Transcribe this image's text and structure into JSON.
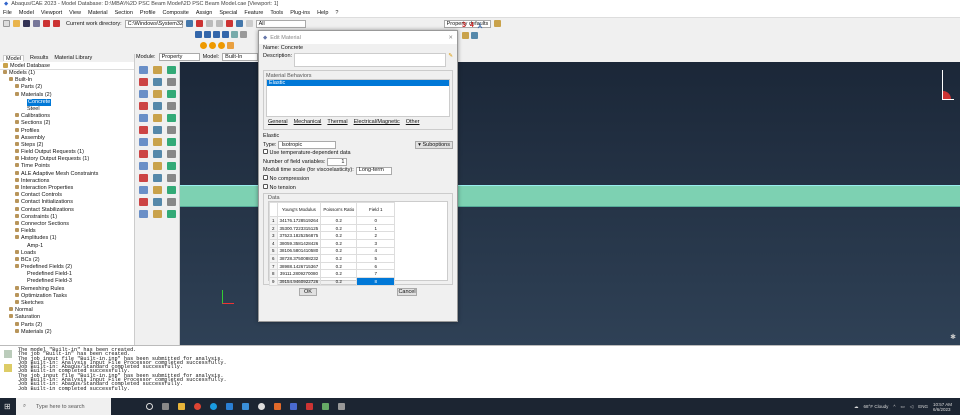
{
  "window": {
    "title": "Abaqus/CAE 2023 - Model Database: D:\\MBA\\%2D PSC Beam Model\\2D PSC Beam Model.cae [Viewport: 1]"
  },
  "menu": [
    "File",
    "Model",
    "Viewport",
    "View",
    "Material",
    "Section",
    "Profile",
    "Composite",
    "Assign",
    "Special",
    "Feature",
    "Tools",
    "Plug-ins",
    "Help",
    "?"
  ],
  "toolbar": {
    "workdir_label": "Current work directory:",
    "workdir_value": "C:\\Windows\\System32",
    "filter_value": "All",
    "property_defaults": "Property defaults"
  },
  "module_bar": {
    "module_label": "Module:",
    "module_value": "Property",
    "model_label": "Model:",
    "model_value": "Built-In"
  },
  "left_panel": {
    "tabs": [
      "Model",
      "Results",
      "Material Library"
    ],
    "header": "Model Database",
    "tree": [
      {
        "t": "Models (1)",
        "d": 0
      },
      {
        "t": "Built-In",
        "d": 1
      },
      {
        "t": "Parts (2)",
        "d": 2
      },
      {
        "t": "Materials (2)",
        "d": 2
      },
      {
        "t": "Concrete",
        "d": 3,
        "sel": true
      },
      {
        "t": "Steel",
        "d": 3
      },
      {
        "t": "Calibrations",
        "d": 2
      },
      {
        "t": "Sections (2)",
        "d": 2
      },
      {
        "t": "Profiles",
        "d": 2
      },
      {
        "t": "Assembly",
        "d": 2
      },
      {
        "t": "Steps (2)",
        "d": 2
      },
      {
        "t": "Field Output Requests (1)",
        "d": 2
      },
      {
        "t": "History Output Requests (1)",
        "d": 2
      },
      {
        "t": "Time Points",
        "d": 2
      },
      {
        "t": "ALE Adaptive Mesh Constraints",
        "d": 2
      },
      {
        "t": "Interactions",
        "d": 2
      },
      {
        "t": "Interaction Properties",
        "d": 2
      },
      {
        "t": "Contact Controls",
        "d": 2
      },
      {
        "t": "Contact Initializations",
        "d": 2
      },
      {
        "t": "Contact Stabilizations",
        "d": 2
      },
      {
        "t": "Constraints (1)",
        "d": 2
      },
      {
        "t": "Connector Sections",
        "d": 2
      },
      {
        "t": "Fields",
        "d": 2
      },
      {
        "t": "Amplitudes (1)",
        "d": 2
      },
      {
        "t": "Amp-1",
        "d": 3
      },
      {
        "t": "Loads",
        "d": 2
      },
      {
        "t": "BCs (2)",
        "d": 2
      },
      {
        "t": "Predefined Fields (2)",
        "d": 2
      },
      {
        "t": "Predefined Field-1",
        "d": 3
      },
      {
        "t": "Predefined Field-3",
        "d": 3
      },
      {
        "t": "Remeshing Rules",
        "d": 2
      },
      {
        "t": "Optimization Tasks",
        "d": 2
      },
      {
        "t": "Sketches",
        "d": 2
      },
      {
        "t": "Normal",
        "d": 1
      },
      {
        "t": "Saturation",
        "d": 1
      },
      {
        "t": "Parts (2)",
        "d": 2
      },
      {
        "t": "Materials (2)",
        "d": 2
      }
    ]
  },
  "dialog": {
    "title": "Edit Material",
    "name_label": "Name:",
    "name_value": "Concrete",
    "description_label": "Description:",
    "behaviors_label": "Material Behaviors",
    "behaviors": [
      "Elastic"
    ],
    "tabs": [
      "General",
      "Mechanical",
      "Thermal",
      "Electrical/Magnetic",
      "Other"
    ],
    "section": "Elastic",
    "type_label": "Type:",
    "type_value": "Isotropic",
    "suboptions": "Suboptions",
    "temp_dep": "Use temperature-dependent data",
    "fields_label": "Number of field variables:",
    "fields_value": "1",
    "moduli_label": "Moduli time scale (for viscoelasticity):",
    "moduli_value": "Long-term",
    "no_compression": "No compression",
    "no_tension": "No tension",
    "data_label": "Data",
    "columns": [
      "Young's Modulus",
      "Poisson's Ratio",
      "Field 1"
    ],
    "rows": [
      [
        "1",
        "34176.1728519264",
        "0.2",
        "0"
      ],
      [
        "2",
        "35300.7223315125",
        "0.2",
        "1"
      ],
      [
        "3",
        "37523.1825256875",
        "0.2",
        "2"
      ],
      [
        "4",
        "38059.3581428426",
        "0.2",
        "3"
      ],
      [
        "5",
        "38106.5801410580",
        "0.2",
        "4"
      ],
      [
        "6",
        "38728.3750088232",
        "0.2",
        "5"
      ],
      [
        "7",
        "38988.1426715367",
        "0.2",
        "6"
      ],
      [
        "8",
        "39111.2809270080",
        "0.2",
        "7"
      ],
      [
        "9",
        "39154.9460922726",
        "0.2",
        "8"
      ]
    ],
    "ok": "OK",
    "cancel": "Cancel"
  },
  "messages": [
    "The model \"Built-in\" has been created.",
    "The job \"Built-in\" has been created.",
    "The job input file \"Built-in.inp\" has been submitted for analysis.",
    "Job Built-in: Analysis Input File Processor completed successfully.",
    "Job Built-in: Abaqus/Standard completed successfully.",
    "Job Built-in completed successfully.",
    "The job input file \"Built-in.inp\" has been submitted for analysis.",
    "Job Built-in: Analysis Input File Processor completed successfully.",
    "Job Built-in: Abaqus/Standard completed successfully.",
    "Job Built-in completed successfully."
  ],
  "taskbar": {
    "search_placeholder": "Type here to search",
    "weather": "68°F Cloudy",
    "lang": "ENG",
    "time": "10:57 AM",
    "date": "6/6/2023"
  },
  "colors": {
    "viewport_top": "#1b2738",
    "viewport_bottom": "#2f4156",
    "beam": "#7dd1b2",
    "selection": "#0078d7"
  }
}
